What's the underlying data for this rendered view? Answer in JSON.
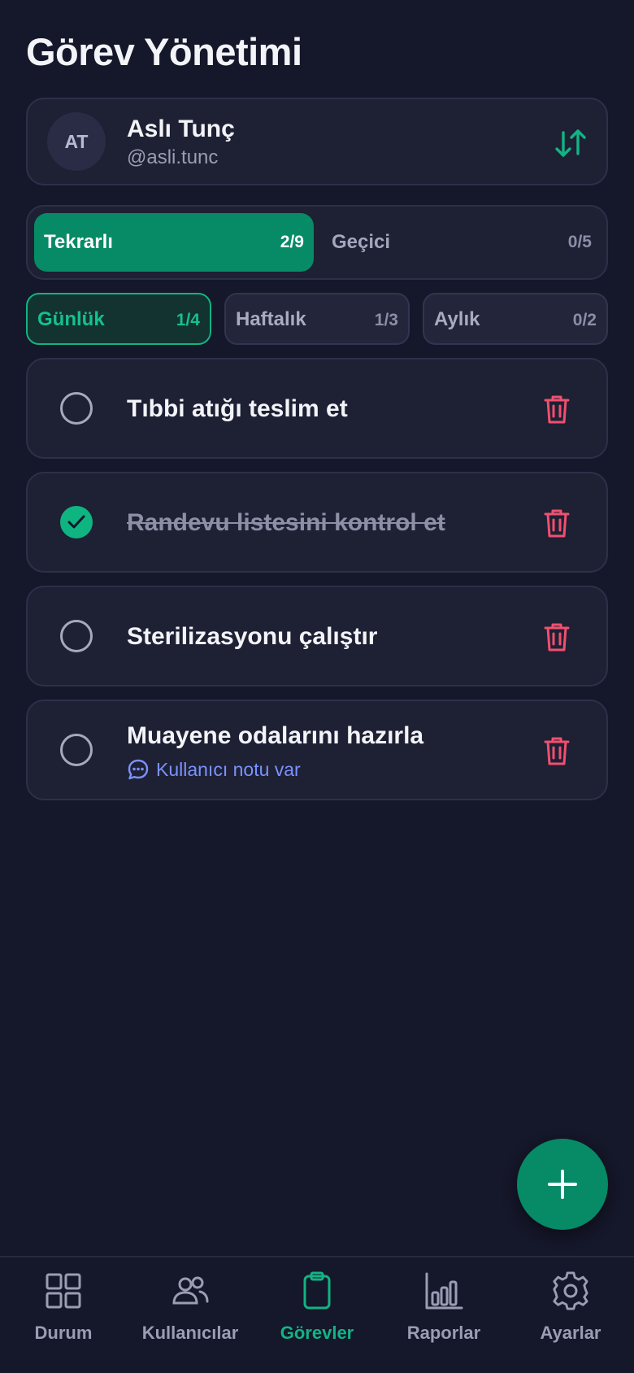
{
  "header": {
    "title": "Görev Yönetimi"
  },
  "user": {
    "initials": "AT",
    "name": "Aslı Tunç",
    "handle": "@asli.tunc",
    "switch_icon": "swap-vertical-icon"
  },
  "task_type_tabs": [
    {
      "label": "Tekrarlı",
      "count": "2/9",
      "active": true
    },
    {
      "label": "Geçici",
      "count": "0/5",
      "active": false
    }
  ],
  "period_tabs": [
    {
      "label": "Günlük",
      "count": "1/4",
      "active": true
    },
    {
      "label": "Haftalık",
      "count": "1/3",
      "active": false
    },
    {
      "label": "Aylık",
      "count": "0/2",
      "active": false
    }
  ],
  "tasks": [
    {
      "title": "Tıbbi atığı teslim et",
      "done": false
    },
    {
      "title": "Randevu listesini kontrol et",
      "done": true
    },
    {
      "title": "Sterilizasyonu çalıştır",
      "done": false
    },
    {
      "title": "Muayene odalarını hazırla",
      "done": false,
      "note": "Kullanıcı notu var"
    }
  ],
  "fab": {
    "icon": "plus-icon"
  },
  "bottom_nav": [
    {
      "label": "Durum",
      "icon": "grid-icon",
      "active": false
    },
    {
      "label": "Kullanıcılar",
      "icon": "users-icon",
      "active": false
    },
    {
      "label": "Görevler",
      "icon": "clipboard-icon",
      "active": true
    },
    {
      "label": "Raporlar",
      "icon": "bar-chart-icon",
      "active": false
    },
    {
      "label": "Ayarlar",
      "icon": "gear-icon",
      "active": false
    }
  ],
  "colors": {
    "background": "#15172a",
    "card": "#1e2034",
    "accent": "#078a66",
    "accent_text": "#13b384",
    "danger": "#f0506e",
    "link": "#7b92ff"
  }
}
